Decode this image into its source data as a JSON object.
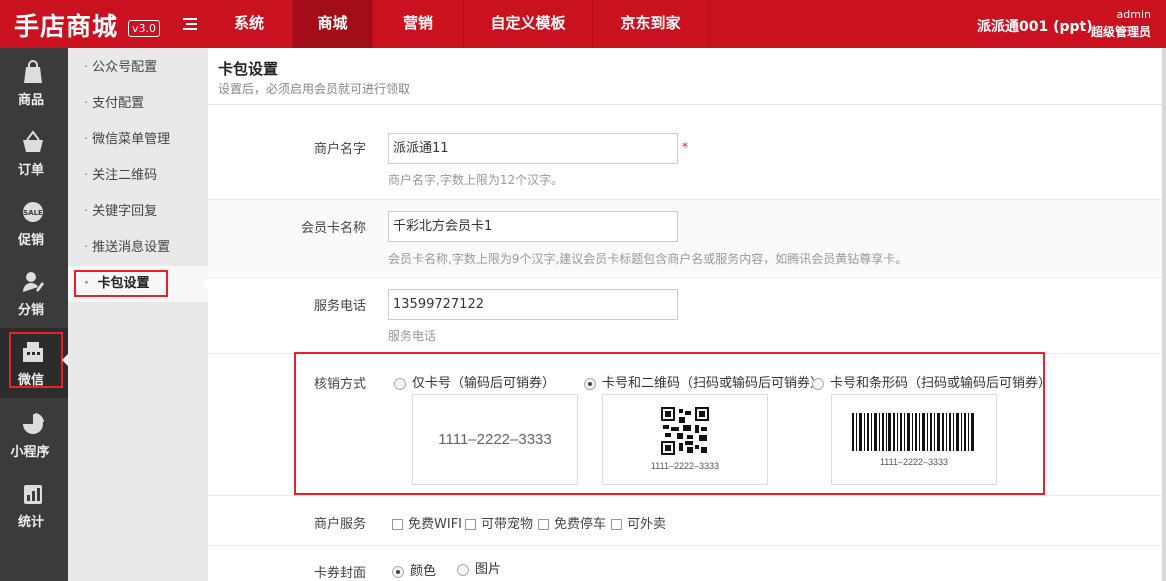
{
  "header": {
    "logo": "手店商城",
    "version": "v3.0",
    "nav": [
      {
        "label": "系统"
      },
      {
        "label": "商城"
      },
      {
        "label": "营销"
      },
      {
        "label": "自定义模板"
      },
      {
        "label": "京东到家"
      }
    ],
    "shop_name": "派派通001 (ppt)",
    "user": "admin",
    "role": "超级管理员"
  },
  "sidebar": {
    "items": [
      {
        "label": "商品",
        "icon": "bag-icon"
      },
      {
        "label": "订单",
        "icon": "basket-icon"
      },
      {
        "label": "促销",
        "icon": "sale-tag-icon"
      },
      {
        "label": "分销",
        "icon": "user-pen-icon"
      },
      {
        "label": "微信",
        "icon": "register-icon"
      },
      {
        "label": "小程序",
        "icon": "pie-icon"
      },
      {
        "label": "统计",
        "icon": "stats-icon"
      }
    ]
  },
  "submenu": {
    "items": [
      {
        "label": "公众号配置"
      },
      {
        "label": "支付配置"
      },
      {
        "label": "微信菜单管理"
      },
      {
        "label": "关注二维码"
      },
      {
        "label": "关键字回复"
      },
      {
        "label": "推送消息设置"
      },
      {
        "label": "卡包设置"
      }
    ]
  },
  "page": {
    "title": "卡包设置",
    "subtitle": "设置后，必须启用会员就可进行领取"
  },
  "form": {
    "merchant": {
      "label": "商户名字",
      "value": "派派通11",
      "required": "*",
      "hint": "商户名字,字数上限为12个汉字。"
    },
    "card_name": {
      "label": "会员卡名称",
      "value": "千彩北方会员卡1",
      "hint": "会员卡名称,字数上限为9个汉字,建议会员卡标题包含商户名或服务内容，如腾讯会员黄钻尊享卡。"
    },
    "phone": {
      "label": "服务电话",
      "value": "13599727122",
      "hint": "服务电话"
    },
    "verify": {
      "label": "核销方式",
      "selected": "卡号和二维码（扫码或输码后可销券）",
      "options": [
        {
          "label": "仅卡号（输码后可销券）",
          "preview": "1111–2222–3333"
        },
        {
          "label": "卡号和二维码（扫码或输码后可销券）",
          "preview": "1111–2222–3333"
        },
        {
          "label": "卡号和条形码（扫码或输码后可销券）",
          "preview": "1111–2222–3333"
        }
      ]
    },
    "services": {
      "label": "商户服务",
      "options": [
        {
          "label": "免费WIFI"
        },
        {
          "label": "可带宠物"
        },
        {
          "label": "免费停车"
        },
        {
          "label": "可外卖"
        }
      ]
    },
    "cover": {
      "label": "卡券封面",
      "selected": "颜色",
      "options": [
        {
          "label": "颜色"
        },
        {
          "label": "图片"
        }
      ]
    }
  },
  "colors": {
    "brand_red": "#c9111f",
    "highlight_red": "#e8202a",
    "sidebar_dark": "#3b3b3b"
  }
}
